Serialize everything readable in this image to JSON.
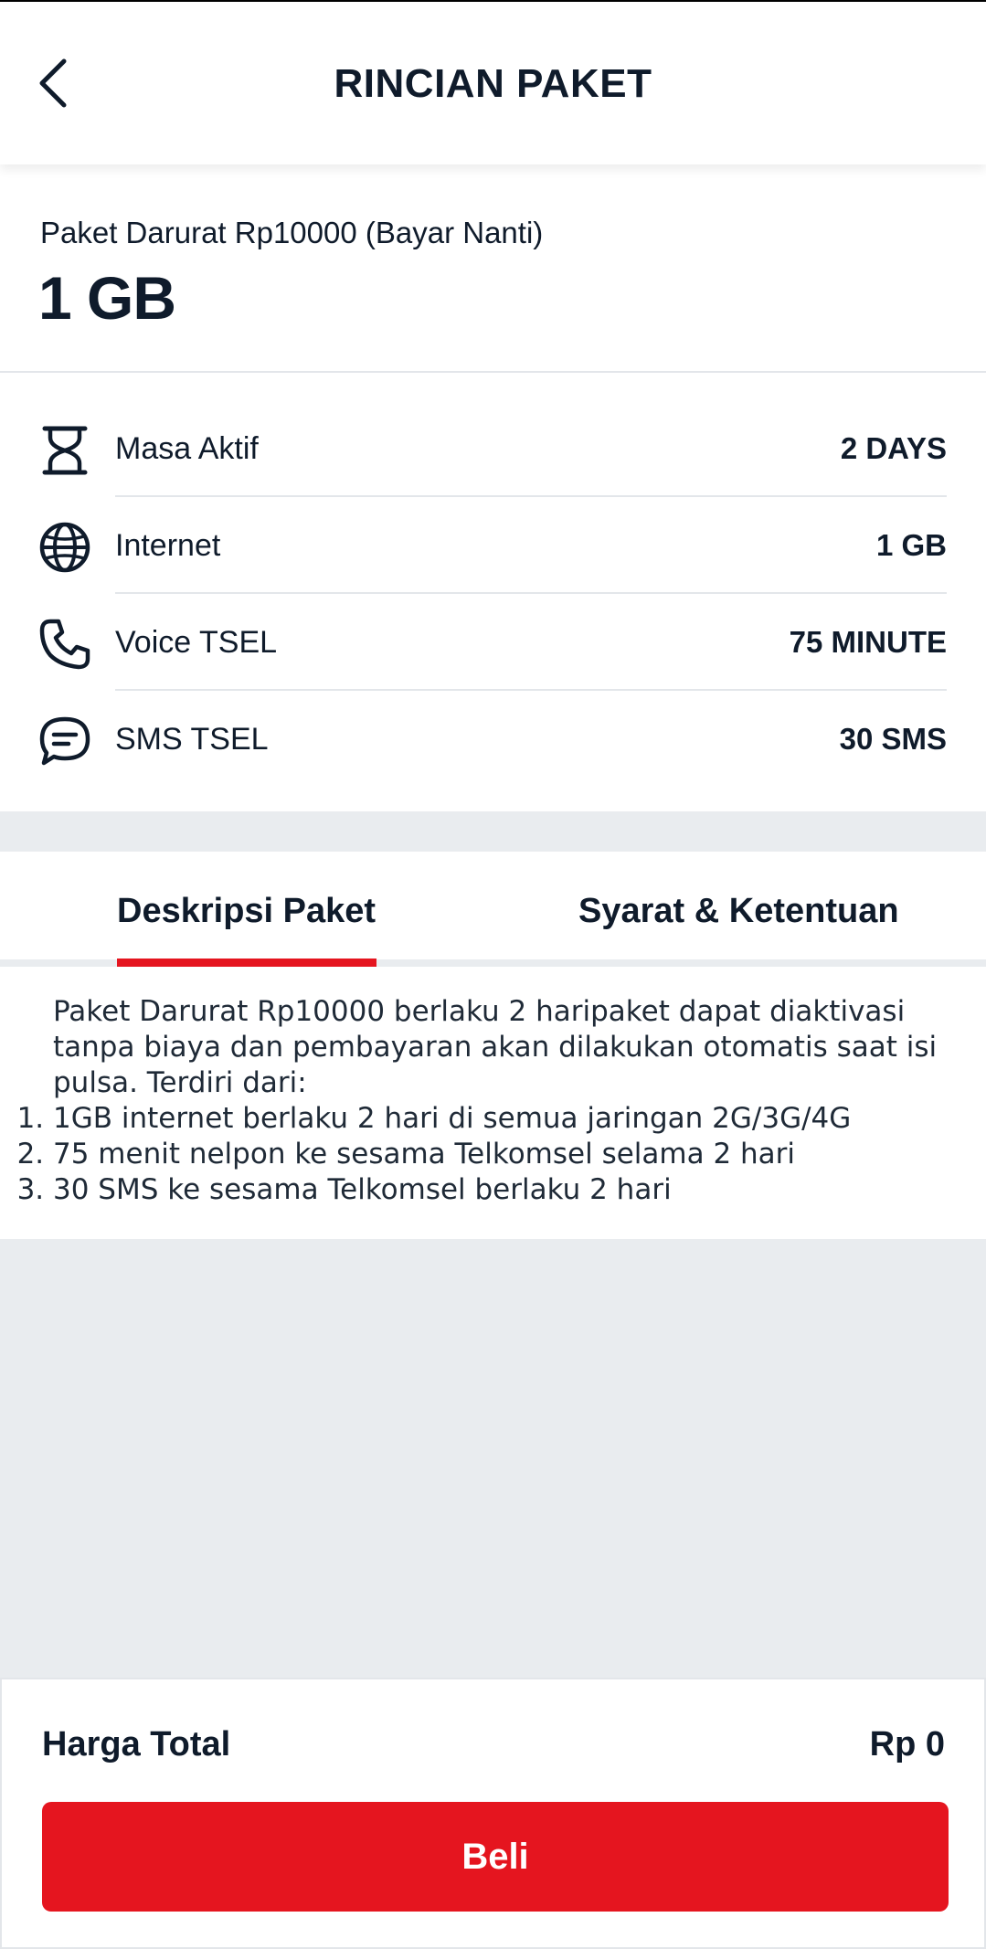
{
  "header": {
    "title": "RINCIAN PAKET",
    "back_icon": "chevron-left-icon"
  },
  "package": {
    "name": "Paket Darurat Rp10000 (Bayar Nanti)",
    "quota": "1 GB"
  },
  "benefits": [
    {
      "icon": "hourglass-icon",
      "label": "Masa Aktif",
      "value": "2 DAYS"
    },
    {
      "icon": "globe-icon",
      "label": "Internet",
      "value": "1 GB"
    },
    {
      "icon": "phone-icon",
      "label": "Voice TSEL",
      "value": "75 MINUTE"
    },
    {
      "icon": "chat-icon",
      "label": "SMS TSEL",
      "value": "30 SMS"
    }
  ],
  "tabs": [
    {
      "label": "Deskripsi Paket",
      "active": true
    },
    {
      "label": "Syarat & Ketentuan",
      "active": false
    }
  ],
  "description": {
    "intro": "Paket Darurat Rp10000 berlaku 2 haripaket dapat diaktivasi tanpa biaya dan pembayaran akan dilakukan otomatis saat isi pulsa. Terdiri dari:",
    "items": [
      "1GB internet berlaku 2 hari di semua jaringan 2G/3G/4G",
      "75 menit nelpon ke sesama Telkomsel selama 2 hari",
      "30 SMS ke sesama Telkomsel berlaku 2 hari"
    ]
  },
  "footer": {
    "total_label": "Harga Total",
    "total_value": "Rp 0",
    "buy_label": "Beli"
  },
  "colors": {
    "accent": "#e5151f",
    "text": "#0f1b2b",
    "background": "#e9ecef"
  }
}
